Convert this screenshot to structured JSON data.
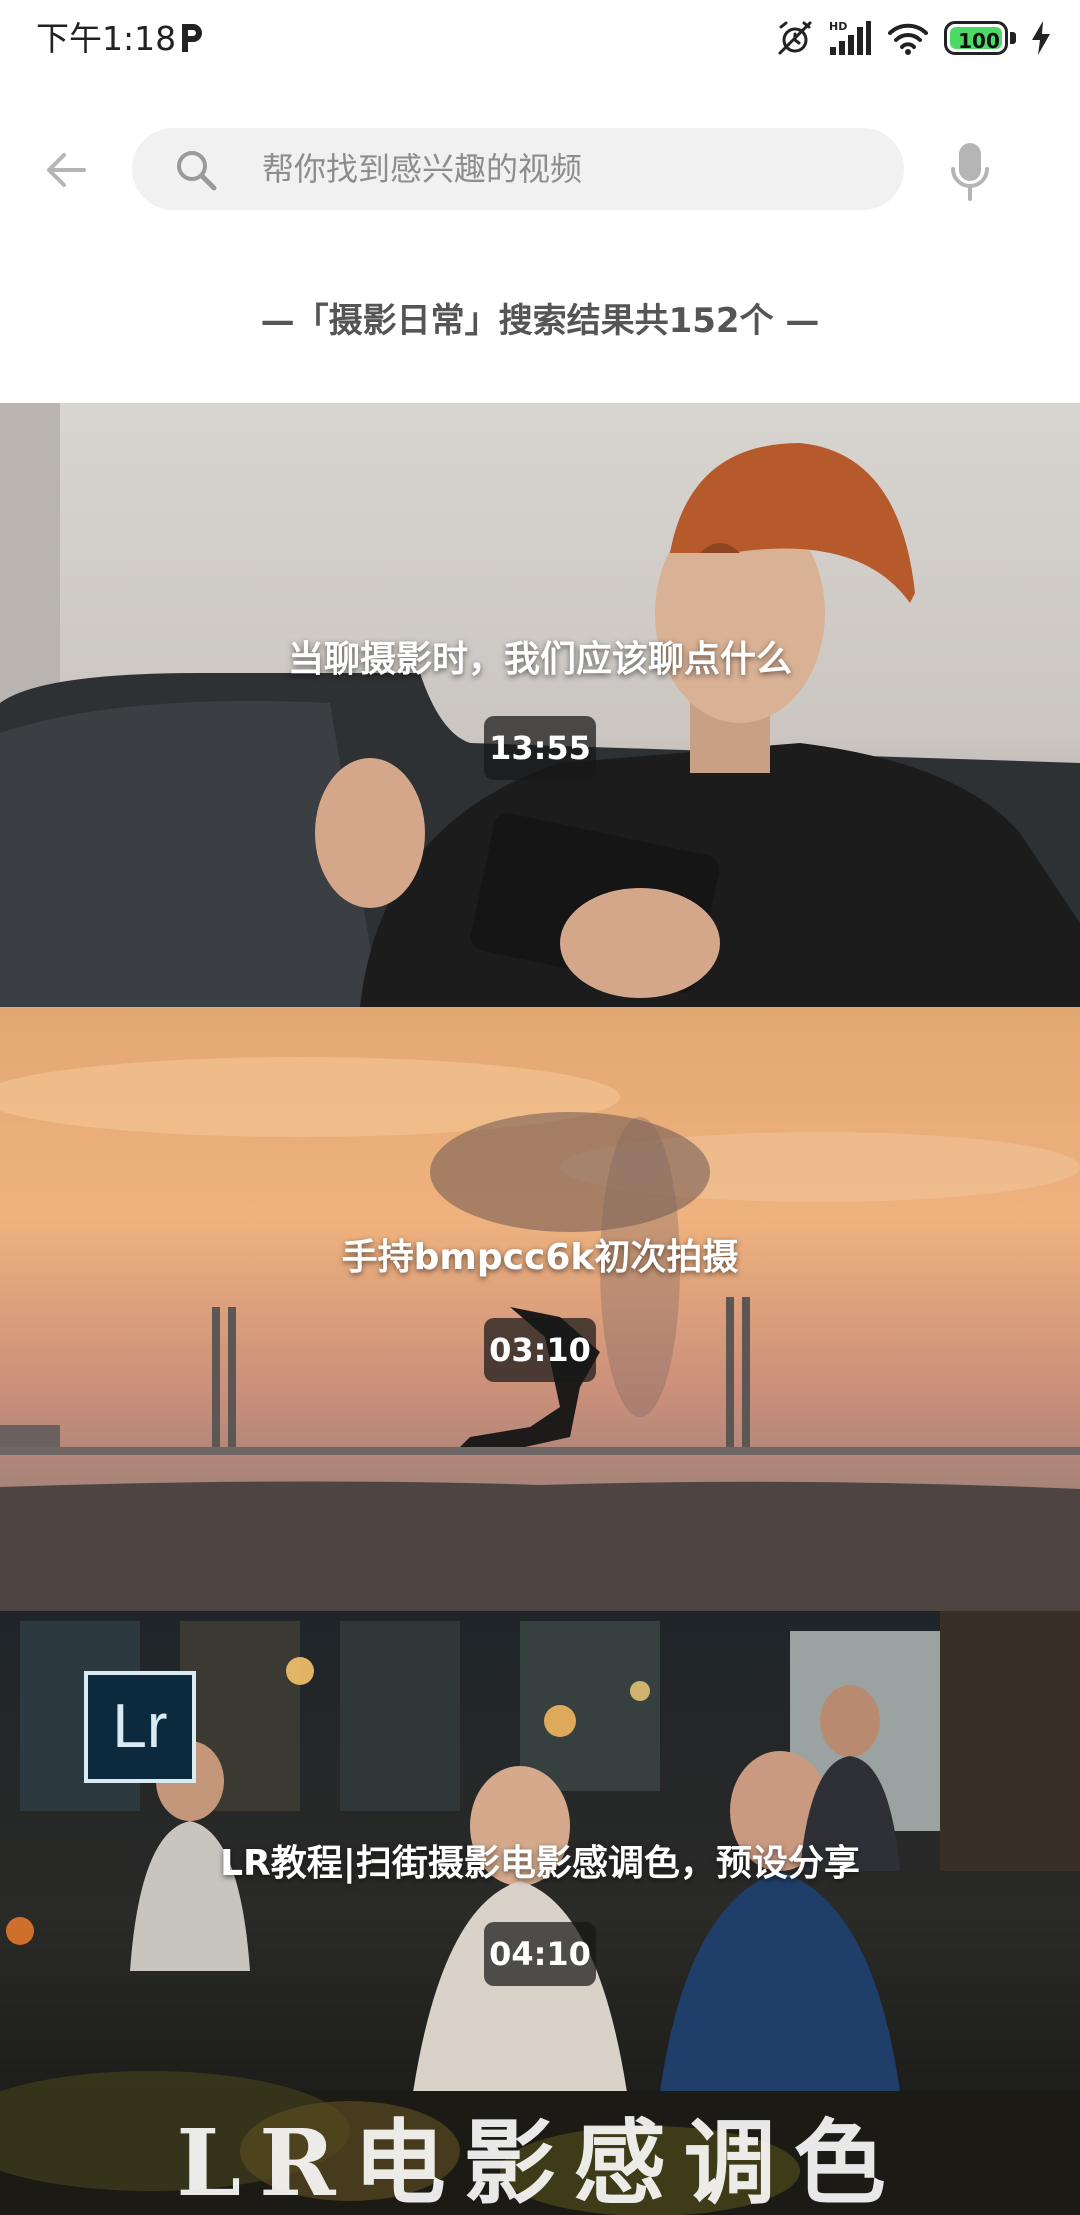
{
  "status_bar": {
    "time": "下午1:18",
    "battery": "100",
    "battery_level": 1.0
  },
  "search": {
    "placeholder": "帮你找到感兴趣的视频",
    "value": ""
  },
  "results": {
    "summary": "—「摄影日常」搜索结果共152个 —"
  },
  "videos": [
    {
      "title": "当聊摄影时，我们应该聊点什么",
      "duration": "13:55"
    },
    {
      "title": "手持bmpcc6k初次拍摄",
      "duration": "03:10"
    },
    {
      "title": "LR教程|扫街摄影电影感调色，预设分享",
      "duration": "04:10",
      "logo_text": "Lr",
      "caption": "LR电影感调色"
    }
  ],
  "colors": {
    "search_background": "#f1f1f1",
    "placeholder": "#8d8d8d",
    "icon_gray": "#b5b5b5",
    "battery_fill": "#4cd964"
  }
}
